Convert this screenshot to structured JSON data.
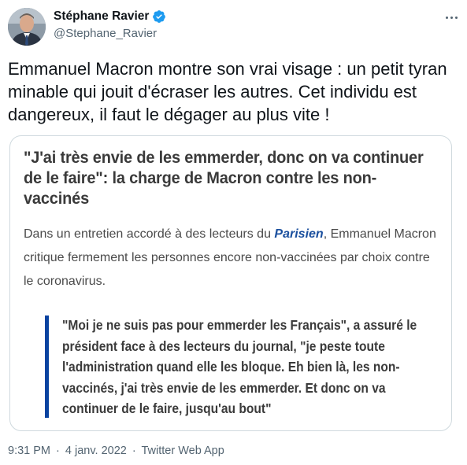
{
  "author": {
    "display_name": "Stéphane Ravier",
    "handle": "@Stephane_Ravier",
    "verified_icon": "verified-badge-icon",
    "verified_color": "#1d9bf0"
  },
  "tweet": {
    "text": "Emmanuel Macron montre son vrai visage : un petit tyran minable qui jouit d'écraser les autres. Cet individu est dangereux, il faut le dégager au plus vite !"
  },
  "card": {
    "title": "\"J'ai très envie de les emmerder, donc on va continuer de le faire\": la charge de Macron contre les non-vaccinés",
    "lead_before": "Dans un entretien accordé à des lecteurs du ",
    "lead_em": "Parisien",
    "lead_after": ", Emmanuel Macron critique fermement les personnes encore non-vaccinées par choix contre le coronavirus.",
    "quote": "\"Moi je ne suis pas pour emmerder les Français\", a assuré le président face à des lecteurs du journal, \"je peste toute l'administration quand elle les bloque. Eh bien là, les non-vaccinés, j'ai très envie de les emmerder. Et donc on va continuer de le faire, jusqu'au bout\"",
    "quote_bar_color": "#0a43a0"
  },
  "meta": {
    "time": "9:31 PM",
    "separator": "·",
    "date": "4 janv. 2022",
    "source": "Twitter Web App"
  }
}
